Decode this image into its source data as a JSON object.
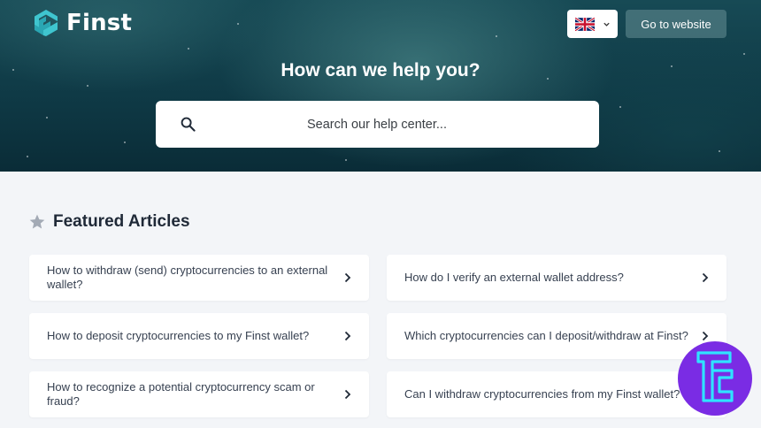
{
  "header": {
    "brand": "Finst",
    "language_selected": "English (UK)",
    "go_to_website": "Go to website"
  },
  "hero": {
    "title": "How can we help you?",
    "search_placeholder": "Search our help center..."
  },
  "featured": {
    "title": "Featured Articles",
    "articles": [
      {
        "label": "How to withdraw (send) cryptocurrencies to an external wallet?"
      },
      {
        "label": "How do I verify an external wallet address?"
      },
      {
        "label": "How to deposit cryptocurrencies to my Finst wallet?"
      },
      {
        "label": "Which cryptocurrencies can I deposit/withdraw at Finst?"
      },
      {
        "label": "How to recognize a potential cryptocurrency scam or fraud?"
      },
      {
        "label": "Can I withdraw cryptocurrencies from my Finst wallet?"
      }
    ]
  },
  "colors": {
    "hero_dark": "#0f3a46",
    "logo_teal": "#3fc5cf",
    "badge_purple": "#7a2ce4",
    "badge_cyan": "#2fe3ff"
  }
}
